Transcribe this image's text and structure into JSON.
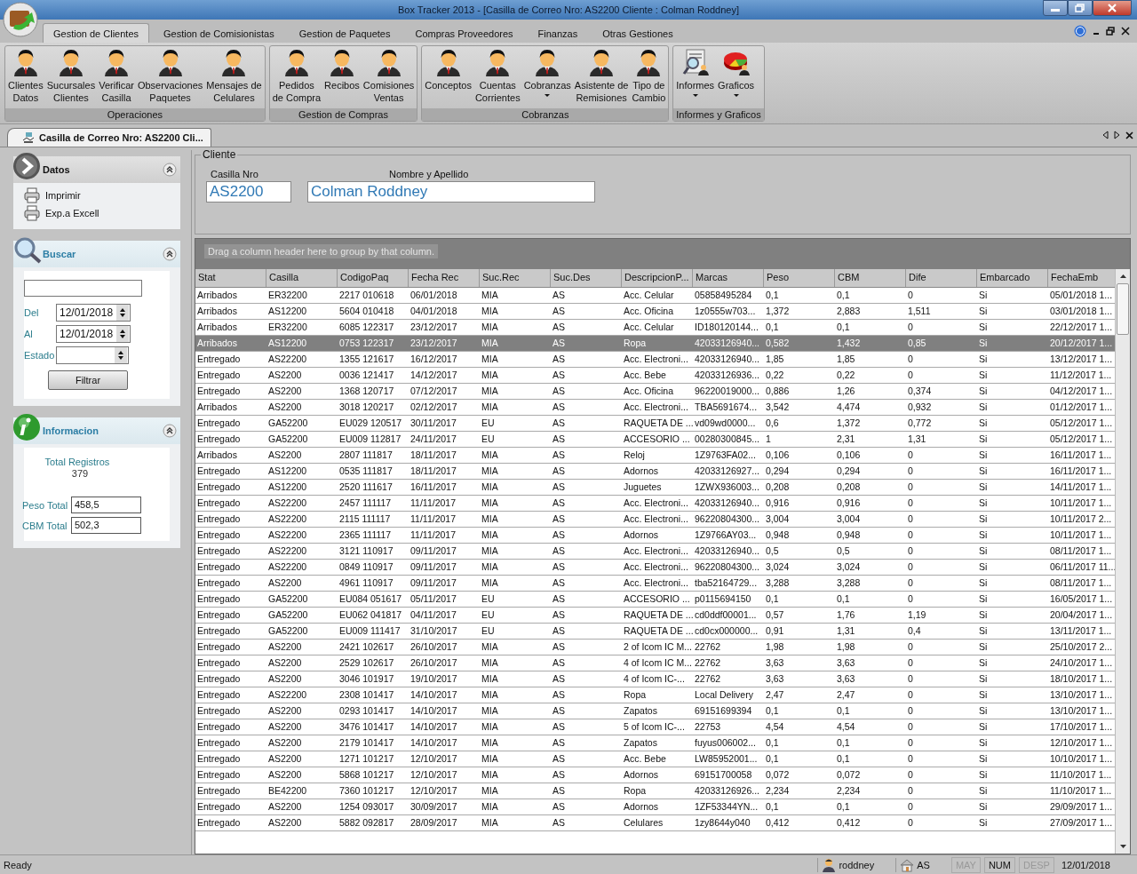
{
  "window": {
    "title": "Box Tracker 2013 - [Casilla de Correo Nro: AS2200 Cliente : Colman Roddney]"
  },
  "ribbon": {
    "tabs": [
      {
        "label": "Gestion de Clientes",
        "selected": true
      },
      {
        "label": "Gestion de Comisionistas",
        "selected": false
      },
      {
        "label": "Gestion de Paquetes",
        "selected": false
      },
      {
        "label": "Compras  Proveedores",
        "selected": false
      },
      {
        "label": "Finanzas",
        "selected": false
      },
      {
        "label": "Otras Gestiones",
        "selected": false
      }
    ],
    "groups": [
      {
        "label": "Operaciones",
        "buttons": [
          {
            "lines": [
              "Clientes",
              "Datos"
            ],
            "kind": "person",
            "dropdown": false
          },
          {
            "lines": [
              "Sucursales",
              "Clientes"
            ],
            "kind": "person",
            "dropdown": false
          },
          {
            "lines": [
              "Verificar",
              "Casilla"
            ],
            "kind": "person",
            "dropdown": false
          },
          {
            "lines": [
              "Observaciones",
              "Paquetes"
            ],
            "kind": "person",
            "dropdown": false
          },
          {
            "lines": [
              "Mensajes de",
              "Celulares"
            ],
            "kind": "person",
            "dropdown": false
          }
        ]
      },
      {
        "label": "Gestion de Compras",
        "buttons": [
          {
            "lines": [
              "Pedidos",
              "de Compra"
            ],
            "kind": "person",
            "dropdown": false
          },
          {
            "lines": [
              "Recibos"
            ],
            "kind": "person",
            "dropdown": false
          },
          {
            "lines": [
              "Comisiones",
              "Ventas"
            ],
            "kind": "person",
            "dropdown": false
          }
        ]
      },
      {
        "label": "Cobranzas",
        "buttons": [
          {
            "lines": [
              "Conceptos"
            ],
            "kind": "person",
            "dropdown": false
          },
          {
            "lines": [
              "Cuentas",
              "Corrientes"
            ],
            "kind": "person",
            "dropdown": false
          },
          {
            "lines": [
              "Cobranzas"
            ],
            "kind": "person",
            "dropdown": true
          },
          {
            "lines": [
              "Asistente de",
              "Remisiones"
            ],
            "kind": "person",
            "dropdown": false
          },
          {
            "lines": [
              "Tipo de",
              "Cambio"
            ],
            "kind": "person",
            "dropdown": false
          }
        ]
      },
      {
        "label": "Informes y Graficos",
        "buttons": [
          {
            "lines": [
              "Informes"
            ],
            "kind": "report",
            "dropdown": true
          },
          {
            "lines": [
              "Graficos"
            ],
            "kind": "chart",
            "dropdown": true
          }
        ]
      }
    ]
  },
  "document_tabs": [
    {
      "label": "Casilla de Correo Nro: AS2200 Cli...",
      "selected": true
    }
  ],
  "sidebar": {
    "datos": {
      "title": "Datos",
      "actions": [
        "Imprimir",
        "Exp.a Excell"
      ]
    },
    "buscar": {
      "title": "Buscar",
      "dates": [
        {
          "label": "Del",
          "value": "12/01/2018"
        },
        {
          "label": "Al",
          "value": "12/01/2018"
        }
      ],
      "estado_label": "Estado",
      "filter_button": "Filtrar"
    },
    "informacion": {
      "title": "Informacion",
      "total_label": "Total Registros",
      "total_value": "379",
      "fields": [
        {
          "label": "Peso Total",
          "value": "458,5"
        },
        {
          "label": "CBM Total",
          "value": "502,3"
        }
      ]
    }
  },
  "cliente": {
    "legend": "Cliente",
    "fields": [
      {
        "label": "Casilla Nro",
        "value": "AS2200"
      },
      {
        "label": "Nombre y Apellido",
        "value": "Colman Roddney"
      }
    ]
  },
  "grid": {
    "group_hint": "Drag a column header here to group by that column.",
    "columns": [
      "Stat",
      "Casilla",
      "CodigoPaq",
      "Fecha Rec",
      "Suc.Rec",
      "Suc.Des",
      "DescripcionP...",
      "Marcas",
      "Peso",
      "CBM",
      "Dife",
      "Embarcado",
      "FechaEmb"
    ],
    "rows": [
      {
        "selected": false,
        "cells": [
          "Arribados",
          "ER32200",
          "2217 010618",
          "06/01/2018",
          "MIA",
          "AS",
          "Acc. Celular",
          "05858495284",
          "0,1",
          "0,1",
          "0",
          "Si",
          "05/01/2018 1..."
        ]
      },
      {
        "selected": false,
        "cells": [
          "Arribados",
          "AS12200",
          "5604 010418",
          "04/01/2018",
          "MIA",
          "AS",
          "Acc. Oficina",
          "1z0555w703...",
          "1,372",
          "2,883",
          "1,511",
          "Si",
          "03/01/2018 1..."
        ]
      },
      {
        "selected": false,
        "cells": [
          "Arribados",
          "ER32200",
          "6085 122317",
          "23/12/2017",
          "MIA",
          "AS",
          "Acc. Celular",
          "ID180120144...",
          "0,1",
          "0,1",
          "0",
          "Si",
          "22/12/2017 1..."
        ]
      },
      {
        "selected": true,
        "cells": [
          "Arribados",
          "AS12200",
          "0753 122317",
          "23/12/2017",
          "MIA",
          "AS",
          "Ropa",
          "42033126940...",
          "0,582",
          "1,432",
          "0,85",
          "Si",
          "20/12/2017 1..."
        ]
      },
      {
        "selected": false,
        "cells": [
          "Entregado",
          "AS22200",
          "1355 121617",
          "16/12/2017",
          "MIA",
          "AS",
          "Acc. Electroni...",
          "42033126940...",
          "1,85",
          "1,85",
          "0",
          "Si",
          "13/12/2017 1..."
        ]
      },
      {
        "selected": false,
        "cells": [
          "Entregado",
          "AS2200",
          "0036 121417",
          "14/12/2017",
          "MIA",
          "AS",
          "Acc. Bebe",
          "42033126936...",
          "0,22",
          "0,22",
          "0",
          "Si",
          "11/12/2017 1..."
        ]
      },
      {
        "selected": false,
        "cells": [
          "Entregado",
          "AS2200",
          "1368 120717",
          "07/12/2017",
          "MIA",
          "AS",
          "Acc. Oficina",
          "96220019000...",
          "0,886",
          "1,26",
          "0,374",
          "Si",
          "04/12/2017 1..."
        ]
      },
      {
        "selected": false,
        "cells": [
          "Arribados",
          "AS2200",
          "3018 120217",
          "02/12/2017",
          "MIA",
          "AS",
          "Acc. Electroni...",
          "TBA5691674...",
          "3,542",
          "4,474",
          "0,932",
          "Si",
          "01/12/2017 1..."
        ]
      },
      {
        "selected": false,
        "cells": [
          "Entregado",
          "GA52200",
          "EU029 120517",
          "30/11/2017",
          "EU",
          "AS",
          "RAQUETA DE ...",
          "vd09wd0000...",
          "0,6",
          "1,372",
          "0,772",
          "Si",
          "05/12/2017 1..."
        ]
      },
      {
        "selected": false,
        "cells": [
          "Entregado",
          "GA52200",
          "EU009 112817",
          "24/11/2017",
          "EU",
          "AS",
          "ACCESORIO ...",
          "00280300845...",
          "1",
          "2,31",
          "1,31",
          "Si",
          "05/12/2017 1..."
        ]
      },
      {
        "selected": false,
        "cells": [
          "Arribados",
          "AS2200",
          "2807 111817",
          "18/11/2017",
          "MIA",
          "AS",
          "Reloj",
          "1Z9763FA02...",
          "0,106",
          "0,106",
          "0",
          "Si",
          "16/11/2017 1..."
        ]
      },
      {
        "selected": false,
        "cells": [
          "Entregado",
          "AS12200",
          "0535 111817",
          "18/11/2017",
          "MIA",
          "AS",
          "Adornos",
          "42033126927...",
          "0,294",
          "0,294",
          "0",
          "Si",
          "16/11/2017 1..."
        ]
      },
      {
        "selected": false,
        "cells": [
          "Entregado",
          "AS12200",
          "2520 111617",
          "16/11/2017",
          "MIA",
          "AS",
          "Juguetes",
          "1ZWX936003...",
          "0,208",
          "0,208",
          "0",
          "Si",
          "14/11/2017 1..."
        ]
      },
      {
        "selected": false,
        "cells": [
          "Entregado",
          "AS22200",
          "2457 111117",
          "11/11/2017",
          "MIA",
          "AS",
          "Acc. Electroni...",
          "42033126940...",
          "0,916",
          "0,916",
          "0",
          "Si",
          "10/11/2017 1..."
        ]
      },
      {
        "selected": false,
        "cells": [
          "Entregado",
          "AS22200",
          "2115 111117",
          "11/11/2017",
          "MIA",
          "AS",
          "Acc. Electroni...",
          "96220804300...",
          "3,004",
          "3,004",
          "0",
          "Si",
          "10/11/2017 2..."
        ]
      },
      {
        "selected": false,
        "cells": [
          "Entregado",
          "AS22200",
          "2365 111117",
          "11/11/2017",
          "MIA",
          "AS",
          "Adornos",
          "1Z9766AY03...",
          "0,948",
          "0,948",
          "0",
          "Si",
          "10/11/2017 1..."
        ]
      },
      {
        "selected": false,
        "cells": [
          "Entregado",
          "AS22200",
          "3121 110917",
          "09/11/2017",
          "MIA",
          "AS",
          "Acc. Electroni...",
          "42033126940...",
          "0,5",
          "0,5",
          "0",
          "Si",
          "08/11/2017 1..."
        ]
      },
      {
        "selected": false,
        "cells": [
          "Entregado",
          "AS22200",
          "0849 110917",
          "09/11/2017",
          "MIA",
          "AS",
          "Acc. Electroni...",
          "96220804300...",
          "3,024",
          "3,024",
          "0",
          "Si",
          "06/11/2017 11..."
        ]
      },
      {
        "selected": false,
        "cells": [
          "Entregado",
          "AS2200",
          "4961 110917",
          "09/11/2017",
          "MIA",
          "AS",
          "Acc. Electroni...",
          "tba52164729...",
          "3,288",
          "3,288",
          "0",
          "Si",
          "08/11/2017 1..."
        ]
      },
      {
        "selected": false,
        "cells": [
          "Entregado",
          "GA52200",
          "EU084 051617",
          "05/11/2017",
          "EU",
          "AS",
          "ACCESORIO ...",
          "p0115694150",
          "0,1",
          "0,1",
          "0",
          "Si",
          "16/05/2017 1..."
        ]
      },
      {
        "selected": false,
        "cells": [
          "Entregado",
          "GA52200",
          "EU062 041817",
          "04/11/2017",
          "EU",
          "AS",
          "RAQUETA DE ...",
          "cd0ddf00001...",
          "0,57",
          "1,76",
          "1,19",
          "Si",
          "20/04/2017 1..."
        ]
      },
      {
        "selected": false,
        "cells": [
          "Entregado",
          "GA52200",
          "EU009 111417",
          "31/10/2017",
          "EU",
          "AS",
          "RAQUETA DE ...",
          "cd0cx000000...",
          "0,91",
          "1,31",
          "0,4",
          "Si",
          "13/11/2017 1..."
        ]
      },
      {
        "selected": false,
        "cells": [
          "Entregado",
          "AS2200",
          "2421 102617",
          "26/10/2017",
          "MIA",
          "AS",
          "2 of Icom IC M...",
          "22762",
          "1,98",
          "1,98",
          "0",
          "Si",
          "25/10/2017 2..."
        ]
      },
      {
        "selected": false,
        "cells": [
          "Entregado",
          "AS2200",
          "2529 102617",
          "26/10/2017",
          "MIA",
          "AS",
          "4 of Icom IC M...",
          "22762",
          "3,63",
          "3,63",
          "0",
          "Si",
          "24/10/2017 1..."
        ]
      },
      {
        "selected": false,
        "cells": [
          "Entregado",
          "AS2200",
          "3046 101917",
          "19/10/2017",
          "MIA",
          "AS",
          "4 of Icom IC-...",
          "22762",
          "3,63",
          "3,63",
          "0",
          "Si",
          "18/10/2017 1..."
        ]
      },
      {
        "selected": false,
        "cells": [
          "Entregado",
          "AS22200",
          "2308 101417",
          "14/10/2017",
          "MIA",
          "AS",
          "Ropa",
          "Local Delivery",
          "2,47",
          "2,47",
          "0",
          "Si",
          "13/10/2017 1..."
        ]
      },
      {
        "selected": false,
        "cells": [
          "Entregado",
          "AS2200",
          "0293 101417",
          "14/10/2017",
          "MIA",
          "AS",
          "Zapatos",
          "69151699394",
          "0,1",
          "0,1",
          "0",
          "Si",
          "13/10/2017 1..."
        ]
      },
      {
        "selected": false,
        "cells": [
          "Entregado",
          "AS2200",
          "3476 101417",
          "14/10/2017",
          "MIA",
          "AS",
          "5 of Icom IC-...",
          "22753",
          "4,54",
          "4,54",
          "0",
          "Si",
          "17/10/2017 1..."
        ]
      },
      {
        "selected": false,
        "cells": [
          "Entregado",
          "AS2200",
          "2179 101417",
          "14/10/2017",
          "MIA",
          "AS",
          "Zapatos",
          "fuyus006002...",
          "0,1",
          "0,1",
          "0",
          "Si",
          "12/10/2017 1..."
        ]
      },
      {
        "selected": false,
        "cells": [
          "Entregado",
          "AS2200",
          "1271 101217",
          "12/10/2017",
          "MIA",
          "AS",
          "Acc. Bebe",
          "LW85952001...",
          "0,1",
          "0,1",
          "0",
          "Si",
          "10/10/2017 1..."
        ]
      },
      {
        "selected": false,
        "cells": [
          "Entregado",
          "AS2200",
          "5868 101217",
          "12/10/2017",
          "MIA",
          "AS",
          "Adornos",
          "69151700058",
          "0,072",
          "0,072",
          "0",
          "Si",
          "11/10/2017 1..."
        ]
      },
      {
        "selected": false,
        "cells": [
          "Entregado",
          "BE42200",
          "7360 101217",
          "12/10/2017",
          "MIA",
          "AS",
          "Ropa",
          "42033126926...",
          "2,234",
          "2,234",
          "0",
          "Si",
          "11/10/2017 1..."
        ]
      },
      {
        "selected": false,
        "cells": [
          "Entregado",
          "AS2200",
          "1254 093017",
          "30/09/2017",
          "MIA",
          "AS",
          "Adornos",
          "1ZF53344YN...",
          "0,1",
          "0,1",
          "0",
          "Si",
          "29/09/2017 1..."
        ]
      },
      {
        "selected": false,
        "cells": [
          "Entregado",
          "AS2200",
          "5882 092817",
          "28/09/2017",
          "MIA",
          "AS",
          "Celulares",
          "1zy8644y040",
          "0,412",
          "0,412",
          "0",
          "Si",
          "27/09/2017 1..."
        ]
      }
    ]
  },
  "status_bar": {
    "message": "Ready",
    "user": "roddney",
    "branch": "AS",
    "keys": [
      {
        "label": "MAY",
        "on": false
      },
      {
        "label": "NUM",
        "on": true
      },
      {
        "label": "DESP",
        "on": false
      }
    ],
    "date": "12/01/2018"
  }
}
